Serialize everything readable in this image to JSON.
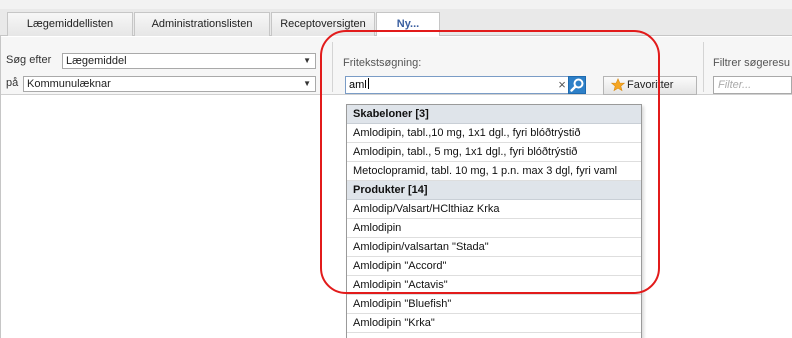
{
  "tabs": [
    {
      "label": "Lægemiddellisten",
      "active": false
    },
    {
      "label": "Administrationslisten",
      "active": false
    },
    {
      "label": "Receptoversigten",
      "active": false
    },
    {
      "label": "Ny...",
      "active": true
    }
  ],
  "search_panel": {
    "search_for_label": "Søg efter",
    "search_for_value": "Lægemiddel",
    "on_label": "på",
    "on_value": "Kommunulæknar"
  },
  "freetext": {
    "label": "Fritekstsøgning:",
    "value": "aml"
  },
  "favorites_button": {
    "label": "Favoritter"
  },
  "filter": {
    "label": "Filtrer søgeresu",
    "placeholder": "Filter..."
  },
  "dropdown": {
    "templates_header": "Skabeloner [3]",
    "templates": [
      "Amlodipin, tabl.,10 mg, 1x1 dgl., fyri blóðtrýstið",
      "Amlodipin, tabl., 5 mg, 1x1 dgl., fyri blóðtrýstið",
      "Metoclopramid, tabl. 10 mg, 1 p.n. max 3 dgl, fyri vaml"
    ],
    "products_header": "Produkter [14]",
    "products": [
      "Amlodip/Valsart/HClthiaz Krka",
      "Amlodipin",
      "Amlodipin/valsartan \"Stada\"",
      "Amlodipin \"Accord\"",
      "Amlodipin \"Actavis\"",
      "Amlodipin \"Bluefish\"",
      "Amlodipin \"Krka\""
    ]
  },
  "colors": {
    "accent_blue": "#2e80c8",
    "annotation_red": "#e21b1b",
    "active_tab_text": "#3a5fa0",
    "favorites_star": "#f5a623"
  },
  "icons": {
    "search_button": "magnifier-icon",
    "favorites": "star-icon",
    "clear": "close-icon",
    "select_arrow": "triangle-down-icon"
  }
}
